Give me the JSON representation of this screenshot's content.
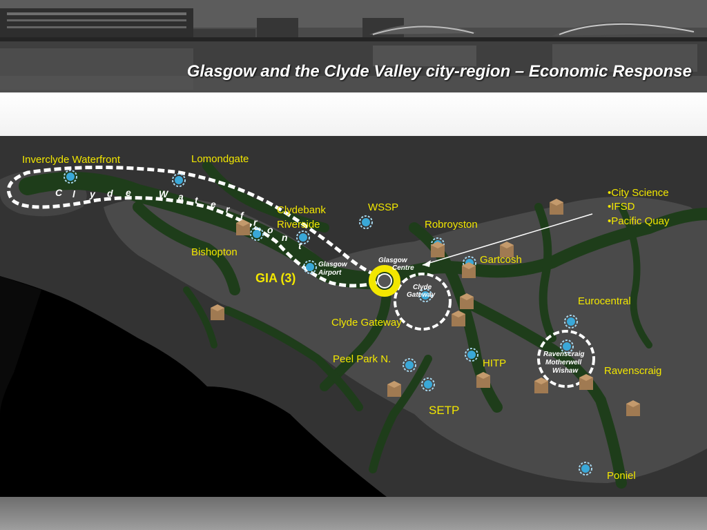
{
  "header": {
    "title": "Glasgow and the Clyde Valley city-region – Economic Response"
  },
  "map": {
    "labels": {
      "inverclyde": "Inverclyde Waterfront",
      "lomondgate": "Lomondgate",
      "clydebank_1": "Clydebank",
      "clydebank_2": "Riverside",
      "wssp": "WSSP",
      "robroyston": "Robroyston",
      "bishopton": "Bishopton",
      "gia": "GIA (3)",
      "gartcosh": "Gartcosh",
      "eurocentral": "Eurocentral",
      "clyde_gateway": "Clyde Gateway",
      "peel_park": "Peel Park N.",
      "hitp": "HITP",
      "ravenscraig": "Ravenscraig",
      "setp": "SETP",
      "poniel": "Poniel",
      "city_science": "•City Science",
      "ifsd": "•IFSD",
      "pacific_quay": "•Pacific Quay"
    },
    "waterfront_letters": [
      "C",
      "l",
      "y",
      "d",
      "e",
      "W",
      "a",
      "t",
      "e",
      "r",
      "f",
      "r",
      "o",
      "n",
      "t"
    ],
    "places": {
      "glasgow_airport_1": "Glasgow",
      "glasgow_airport_2": "Airport",
      "glasgow_centre_1": "Glasgow",
      "glasgow_centre_2": "Centre",
      "clyde_gateway_circle_1": "Clyde",
      "clyde_gateway_circle_2": "Gateway",
      "ravenscraig_circle_1": "Ravenscraig",
      "ravenscraig_circle_2": "Motherwell",
      "ravenscraig_circle_3": "Wishaw"
    },
    "colors": {
      "label": "#f2e700",
      "corridor": "#1e3d1a",
      "urban": "#4a4a4a",
      "land": "#333333",
      "water": "#000000",
      "route": "#ffffff",
      "hub_ring": "#f2e700",
      "star_marker": "#3aa8d8",
      "box_marker": "#a07a52"
    }
  }
}
